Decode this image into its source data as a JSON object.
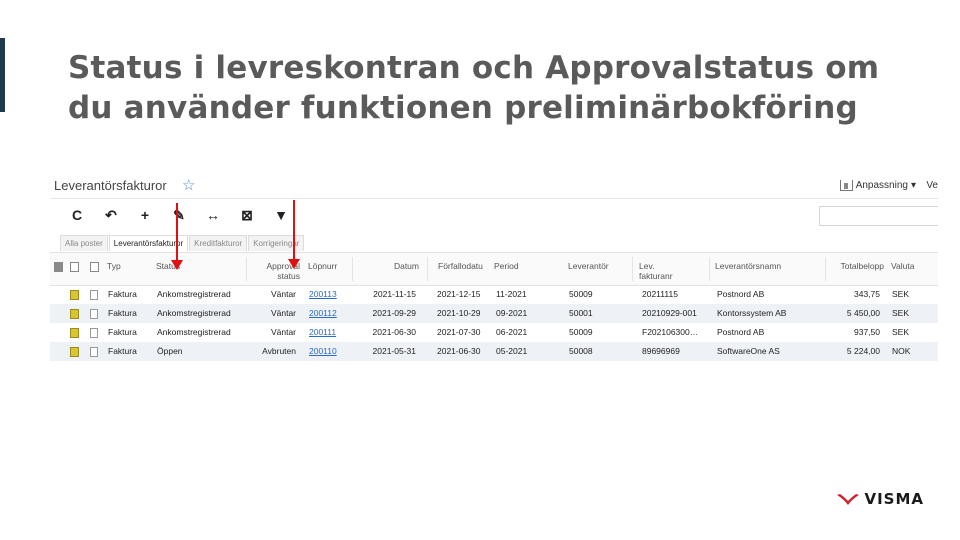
{
  "slide": {
    "title_line1": "Status i levreskontran och Approvalstatus om",
    "title_line2": "du använder funktionen preliminärbokföring"
  },
  "app": {
    "title": "Leverantörsfakturor",
    "customize_label": "Anpassning",
    "customize_caret": "▾",
    "right_truncated": "Ve"
  },
  "toolbar": {
    "refresh": "C",
    "undo": "↶",
    "add": "+",
    "edit": "✎",
    "fit": "↔",
    "export": "⊠",
    "filter": "▼"
  },
  "tabs": [
    "Alla poster",
    "Leverantörsfakturor",
    "Kreditfakturor",
    "Korrigeringar"
  ],
  "columns": {
    "typ": "Typ",
    "status": "Status",
    "approval_1": "Approval",
    "approval_2": "status",
    "lopnr": "Löpnurr",
    "datum": "Datum",
    "forfallo": "Förfallodatu",
    "period": "Period",
    "leverantor": "Leverantör",
    "levfakt_1": "Lev.",
    "levfakt_2": "fakturanr",
    "levnamn": "Leverantörsnamn",
    "total": "Totalbelopp",
    "valuta": "Valuta"
  },
  "rows": [
    {
      "typ": "Faktura",
      "status": "Ankomstregistrerad",
      "approval": "Väntar",
      "lopnr": "200113",
      "datum": "2021-11-15",
      "forfallo": "2021-12-15",
      "period": "11-2021",
      "leverantor": "50009",
      "levfakt": "20211115",
      "levnamn": "Postnord AB",
      "total": "343,75",
      "valuta": "SEK"
    },
    {
      "typ": "Faktura",
      "status": "Ankomstregistrerad",
      "approval": "Väntar",
      "lopnr": "200112",
      "datum": "2021-09-29",
      "forfallo": "2021-10-29",
      "period": "09-2021",
      "leverantor": "50001",
      "levfakt": "20210929-001",
      "levnamn": "Kontorssystem AB",
      "total": "5 450,00",
      "valuta": "SEK"
    },
    {
      "typ": "Faktura",
      "status": "Ankomstregistrerad",
      "approval": "Väntar",
      "lopnr": "200111",
      "datum": "2021-06-30",
      "forfallo": "2021-07-30",
      "period": "06-2021",
      "leverantor": "50009",
      "levfakt": "F202106300…",
      "levnamn": "Postnord AB",
      "total": "937,50",
      "valuta": "SEK"
    },
    {
      "typ": "Faktura",
      "status": "Öppen",
      "approval": "Avbruten",
      "lopnr": "200110",
      "datum": "2021-05-31",
      "forfallo": "2021-06-30",
      "period": "05-2021",
      "leverantor": "50008",
      "levfakt": "89696969",
      "levnamn": "SoftwareOne AS",
      "total": "5 224,00",
      "valuta": "NOK"
    }
  ],
  "logo": {
    "text": "VISMA"
  },
  "colors": {
    "accent": "#1f3a4d",
    "title": "#5a5a5a",
    "arrow": "#e01010",
    "link": "#2a6cc4",
    "logo_red": "#d01e2b"
  }
}
